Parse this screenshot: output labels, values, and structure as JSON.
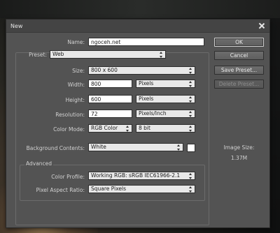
{
  "window": {
    "title": "New"
  },
  "form": {
    "name_label": "Name:",
    "name_value": "ngoceh.net",
    "preset_label": "Preset:",
    "preset_value": "Web",
    "size_label": "Size:",
    "size_value": "800 x 600",
    "width_label": "Width:",
    "width_value": "800",
    "width_unit": "Pixels",
    "height_label": "Height:",
    "height_value": "600",
    "height_unit": "Pixels",
    "resolution_label": "Resolution:",
    "resolution_value": "72",
    "resolution_unit": "Pixels/Inch",
    "color_mode_label": "Color Mode:",
    "color_mode_value": "RGB Color",
    "bit_depth_value": "8 bit",
    "background_label": "Background Contents:",
    "background_value": "White",
    "background_swatch_color": "#ffffff"
  },
  "advanced": {
    "title": "Advanced",
    "color_profile_label": "Color Profile:",
    "color_profile_value": "Working RGB:  sRGB IEC61966-2.1",
    "pixel_aspect_label": "Pixel Aspect Ratio:",
    "pixel_aspect_value": "Square Pixels"
  },
  "buttons": {
    "ok": "OK",
    "cancel": "Cancel",
    "save_preset": "Save Preset...",
    "delete_preset": "Delete Preset..."
  },
  "image_size": {
    "label": "Image Size:",
    "value": "1.37M"
  },
  "colors": {
    "dialog_bg": "#535353",
    "titlebar_bg": "#444444"
  }
}
